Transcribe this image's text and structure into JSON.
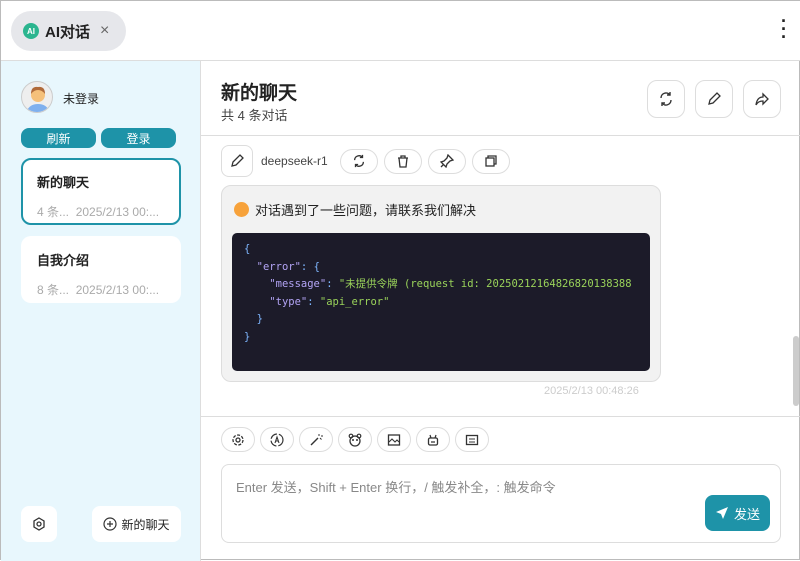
{
  "tab": {
    "title": "AI对话",
    "logo": "AI",
    "close": "×"
  },
  "menu_icon": "more-vertical-icon",
  "sidebar": {
    "user_name": "未登录",
    "refresh_label": "刷新",
    "login_label": "登录",
    "conversations": [
      {
        "title": "新的聊天",
        "count": "4 条...",
        "time": "2025/2/13 00:...",
        "selected": true
      },
      {
        "title": "自我介绍",
        "count": "8 条...",
        "time": "2025/2/13 00:...",
        "selected": false
      }
    ],
    "new_chat_label": "新的聊天"
  },
  "header": {
    "title": "新的聊天",
    "subtitle": "共 4 条对话"
  },
  "message": {
    "model": "deepseek-r1",
    "text": "对话遇到了一些问题，请联系我们解决",
    "code_lines": [
      "{",
      "  \"error\": {",
      "    \"message\": \"未提供令牌 (request id: 20250212164826820138388",
      "    \"type\": \"api_error\"",
      "  }",
      "}"
    ],
    "time": "2025/2/13 00:48:26"
  },
  "input": {
    "placeholder": "Enter 发送，Shift + Enter 换行，/ 触发补全，: 触发命令",
    "value": "",
    "send_label": "发送"
  },
  "colors": {
    "accent": "#1e93a8",
    "sidebar_bg": "#e8f7fd",
    "code_bg": "#1c1b29"
  }
}
